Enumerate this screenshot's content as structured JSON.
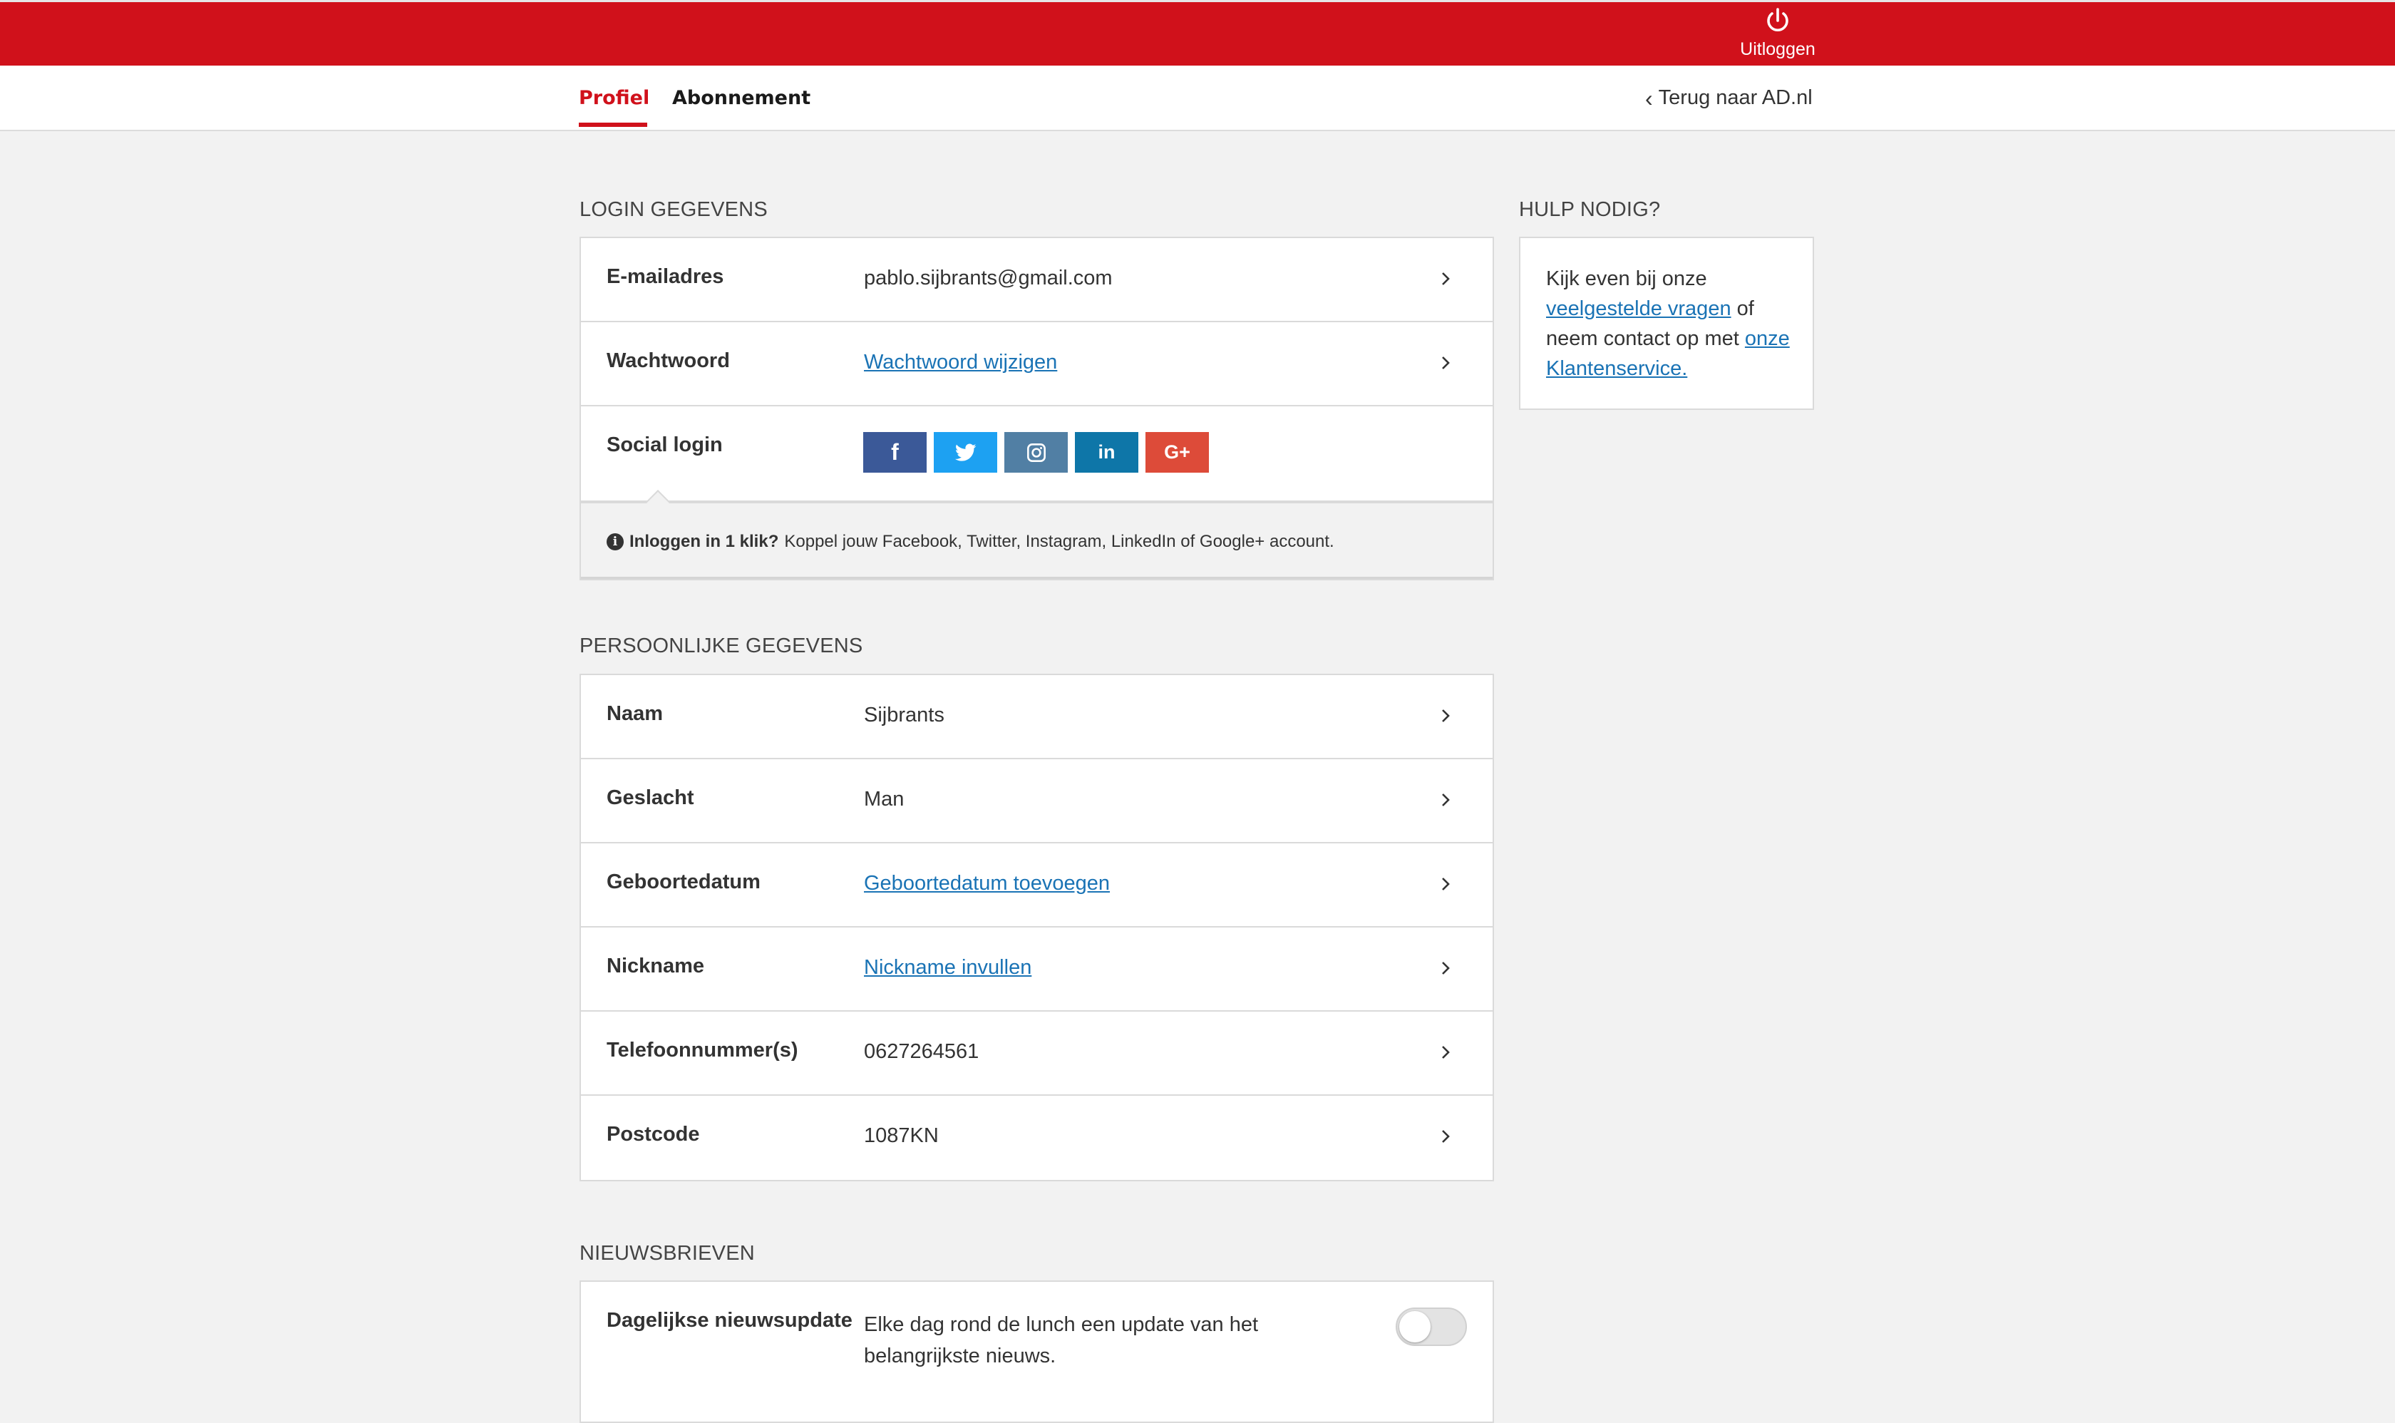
{
  "header": {
    "logout_label": "Uitloggen"
  },
  "nav": {
    "tabs": [
      {
        "label": "Profiel",
        "active": true
      },
      {
        "label": "Abonnement",
        "active": false
      }
    ],
    "back_link": "Terug naar AD.nl"
  },
  "login": {
    "section_title": "LOGIN GEGEVENS",
    "email_label": "E-mailadres",
    "email_value": "pablo.sijbrants@gmail.com",
    "password_label": "Wachtwoord",
    "password_link": "Wachtwoord wijzigen",
    "social_label": "Social login",
    "social_buttons": [
      {
        "name": "facebook",
        "glyph": "f",
        "color": "#3b5998"
      },
      {
        "name": "twitter",
        "glyph": "twitter-bird",
        "color": "#1da1f2"
      },
      {
        "name": "instagram",
        "glyph": "instagram-camera",
        "color": "#517fa4"
      },
      {
        "name": "linkedin",
        "glyph": "in",
        "color": "#0e76a8"
      },
      {
        "name": "googleplus",
        "glyph": "G+",
        "color": "#dd4b39"
      }
    ],
    "info_bold": "Inloggen in 1 klik?",
    "info_text": "Koppel jouw Facebook, Twitter, Instagram, LinkedIn of Google+ account."
  },
  "personal": {
    "section_title": "PERSOONLIJKE GEGEVENS",
    "rows": [
      {
        "label": "Naam",
        "value": "Sijbrants",
        "is_link": false
      },
      {
        "label": "Geslacht",
        "value": "Man",
        "is_link": false
      },
      {
        "label": "Geboortedatum",
        "value": "Geboortedatum toevoegen",
        "is_link": true
      },
      {
        "label": "Nickname",
        "value": "Nickname invullen",
        "is_link": true
      },
      {
        "label": "Telefoonnummer(s)",
        "value": "0627264561",
        "is_link": false
      },
      {
        "label": "Postcode",
        "value": "1087KN",
        "is_link": false
      }
    ]
  },
  "help": {
    "section_title": "HULP NODIG?",
    "text_1": "Kijk even bij onze",
    "link_1": "veelgestelde vragen",
    "text_2": "of neem contact op met",
    "link_2": "onze Klantenservice."
  },
  "newsletters": {
    "section_title": "NIEUWSBRIEVEN",
    "daily_label": "Dagelijkse nieuwsupdate",
    "daily_desc": "Elke dag rond de lunch een update van het belangrijkste nieuws.",
    "daily_enabled": false
  },
  "colors": {
    "brand_red": "#d0111b",
    "link_blue": "#1a73b5"
  }
}
